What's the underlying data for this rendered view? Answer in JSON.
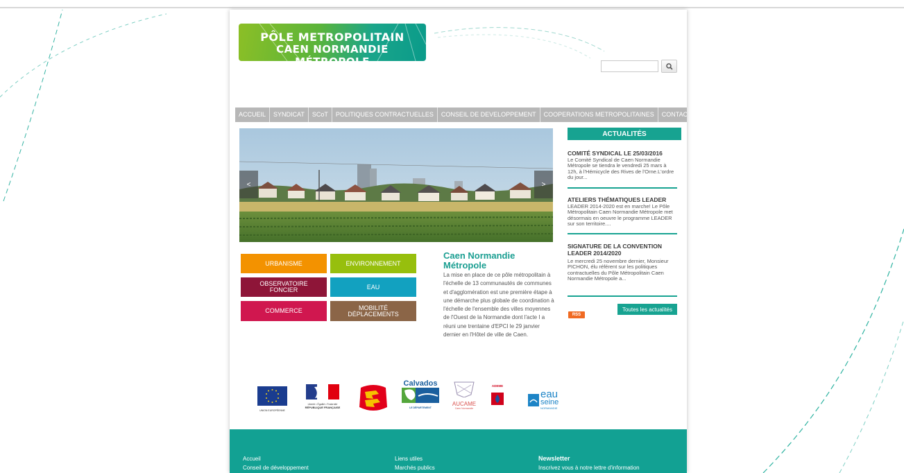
{
  "header": {
    "logo_line1": "PÔLE METROPOLITAIN",
    "logo_line2": "CAEN NORMANDIE MÉTROPOLE",
    "search_placeholder": ""
  },
  "menu": [
    "ACCUEIL",
    "SYNDICAT",
    "SCoT",
    "POLITIQUES CONTRACTUELLES",
    "CONSEIL DE DEVELOPPEMENT",
    "COOPERATIONS METROPOLITAINES",
    "CONTACT"
  ],
  "slider": {
    "prev": "<",
    "next": ">"
  },
  "tiles": [
    {
      "label": "URBANISME",
      "color": "#f39200"
    },
    {
      "label": "ENVIRONNEMENT",
      "color": "#97bf0d"
    },
    {
      "label": "OBSERVATOIRE FONCIER",
      "color": "#8e1538"
    },
    {
      "label": "EAU",
      "color": "#12a1c0"
    },
    {
      "label": "COMMERCE",
      "color": "#d0174f"
    },
    {
      "label": "MOBILITÉ DÉPLACEMENTS",
      "color": "#8b6547"
    }
  ],
  "intro": {
    "title": "Caen Normandie Métropole",
    "text": "La mise en place de ce pôle métropolitain à l'échelle de 13 communautés de communes et d'agglomération est une première étape à une démarche plus globale de coordination à l'échelle de l'ensemble des villes moyennes de l'Ouest de la Normandie dont l'acte I a réuni une trentaine d'EPCI le 29 janvier dernier en l'Hôtel de ville de Caen."
  },
  "news": {
    "heading": "ACTUALITÉS",
    "items": [
      {
        "title": "COMITÉ SYNDICAL LE 25/03/2016",
        "body": "Le Comité Syndical de Caen Normandie Métropole se tiendra le vendredi 25 mars à 12h, à l'Hémicycle des Rives de l'Orne.L'ordre du jour..."
      },
      {
        "title": "ATELIERS THÉMATIQUES LEADER",
        "body": "LEADER 2014-2020 est en marche! Le Pôle Métropolitain Caen Normandie Métropole met désormais en oeuvre le programme LEADER sur son territoire...."
      },
      {
        "title": "SIGNATURE DE LA CONVENTION LEADER 2014/2020",
        "body": "Le mercredi 25 novembre dernier, Monsieur PICHON, élu référent sur les politiques contractuelles du Pôle Métropolitain Caen Normandie Métropole a..."
      }
    ],
    "all_label": "Toutes les actualités",
    "rss_label": "RSS"
  },
  "partners": {
    "eu": "UNION EUROPÉENNE",
    "rf_motto": "Liberté • Égalité • Fraternité",
    "rf": "RÉPUBLIQUE FRANÇAISE",
    "calvados": "Calvados",
    "calvados_sub": "LE DÉPARTEMENT",
    "aucame": "AUCAME",
    "aucame_sub": "Caen Normandie",
    "ademe": "ADEME",
    "eau1": "eau",
    "eau2": "seine",
    "eau3": "NORMANDIE"
  },
  "footer": {
    "col1": [
      "Accueil",
      "Conseil de développement"
    ],
    "col2": [
      "Liens utiles",
      "Marchés publics"
    ],
    "newsletter_title": "Newsletter",
    "newsletter_text": "Inscrivez vous à notre lettre d'information"
  },
  "colors": {
    "accent": "#17a391",
    "menu": "#b7b7b7"
  }
}
